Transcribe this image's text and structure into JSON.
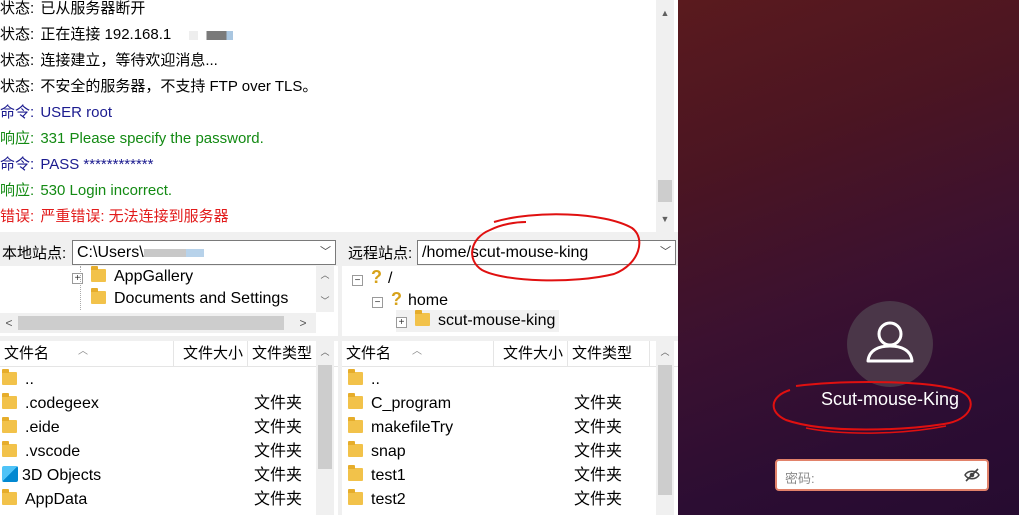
{
  "log": {
    "lines": [
      {
        "prefix": "状态:",
        "text": "已从服务器断开",
        "kind": "status"
      },
      {
        "prefix": "状态:",
        "text": "正在连接 192.168.1",
        "kind": "status"
      },
      {
        "prefix": "状态:",
        "text": "连接建立，等待欢迎消息...",
        "kind": "status"
      },
      {
        "prefix": "状态:",
        "text": "不安全的服务器，不支持 FTP over TLS。",
        "kind": "status"
      },
      {
        "prefix": "命令:",
        "text": "USER root",
        "kind": "command"
      },
      {
        "prefix": "响应:",
        "text": "331 Please specify the password.",
        "kind": "response"
      },
      {
        "prefix": "命令:",
        "text": "PASS ************",
        "kind": "command"
      },
      {
        "prefix": "响应:",
        "text": "530 Login incorrect.",
        "kind": "response"
      },
      {
        "prefix": "错误:",
        "text": "严重错误: 无法连接到服务器",
        "kind": "error"
      }
    ]
  },
  "local": {
    "site_label": "本地站点:",
    "path": "C:\\Users\\",
    "tree": [
      {
        "label": "AppGallery"
      },
      {
        "label": "Documents and Settings"
      }
    ],
    "columns": [
      "文件名",
      "文件大小",
      "文件类型"
    ],
    "files": [
      {
        "name": "..",
        "type": "",
        "icon": "folder"
      },
      {
        "name": ".codegeex",
        "type": "文件夹",
        "icon": "folder"
      },
      {
        "name": ".eide",
        "type": "文件夹",
        "icon": "folder"
      },
      {
        "name": ".vscode",
        "type": "文件夹",
        "icon": "folder"
      },
      {
        "name": "3D Objects",
        "type": "文件夹",
        "icon": "3d-objects"
      },
      {
        "name": "AppData",
        "type": "文件夹",
        "icon": "folder"
      }
    ]
  },
  "remote": {
    "site_label": "远程站点:",
    "path": "/home/scut-mouse-king",
    "tree": [
      {
        "label": "/"
      },
      {
        "label": "home"
      },
      {
        "label": "scut-mouse-king"
      }
    ],
    "columns": [
      "文件名",
      "文件大小",
      "文件类型"
    ],
    "files": [
      {
        "name": "..",
        "type": "",
        "icon": "folder"
      },
      {
        "name": "C_program",
        "type": "文件夹",
        "icon": "folder"
      },
      {
        "name": "makefileTry",
        "type": "文件夹",
        "icon": "folder"
      },
      {
        "name": "snap",
        "type": "文件夹",
        "icon": "folder"
      },
      {
        "name": "test1",
        "type": "文件夹",
        "icon": "folder"
      },
      {
        "name": "test2",
        "type": "文件夹",
        "icon": "folder"
      }
    ]
  },
  "login": {
    "username": "Scut-mouse-King",
    "password_placeholder": "密码:"
  },
  "colors": {
    "status": "#000000",
    "command": "#1b1b8f",
    "response": "#138a13",
    "error": "#e21b1b",
    "annotation": "#e01010",
    "login_bg": "#3b1130"
  }
}
